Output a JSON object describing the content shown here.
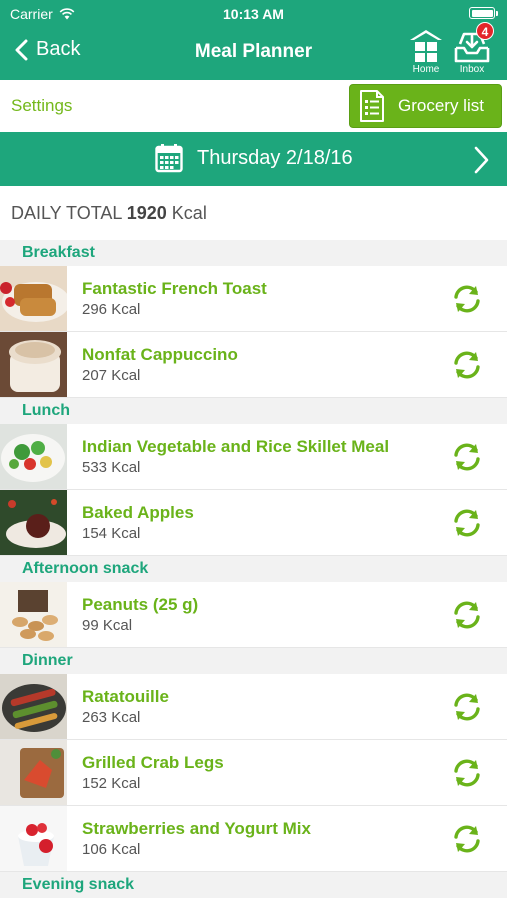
{
  "status_bar": {
    "carrier": "Carrier",
    "time": "10:13 AM"
  },
  "nav": {
    "back_label": "Back",
    "title": "Meal Planner",
    "home_label": "Home",
    "inbox_label": "Inbox",
    "inbox_badge": "4"
  },
  "toolbar": {
    "settings_label": "Settings",
    "grocery_label": "Grocery list"
  },
  "date": {
    "label": "Thursday 2/18/16"
  },
  "daily_total": {
    "prefix": "DAILY TOTAL",
    "value": "1920",
    "unit": "Kcal"
  },
  "sections": [
    {
      "title": "Breakfast",
      "items": [
        {
          "name": "Fantastic French Toast",
          "kcal": "296 Kcal"
        },
        {
          "name": "Nonfat Cappuccino",
          "kcal": "207 Kcal"
        }
      ]
    },
    {
      "title": "Lunch",
      "items": [
        {
          "name": "Indian Vegetable and Rice Skillet Meal",
          "kcal": "533 Kcal"
        },
        {
          "name": "Baked Apples",
          "kcal": "154 Kcal"
        }
      ]
    },
    {
      "title": "Afternoon snack",
      "items": [
        {
          "name": "Peanuts (25 g)",
          "kcal": "99 Kcal"
        }
      ]
    },
    {
      "title": "Dinner",
      "items": [
        {
          "name": "Ratatouille",
          "kcal": "263 Kcal"
        },
        {
          "name": "Grilled Crab Legs",
          "kcal": "152 Kcal"
        },
        {
          "name": "Strawberries and Yogurt Mix",
          "kcal": "106 Kcal"
        }
      ]
    },
    {
      "title": "Evening snack",
      "items": []
    }
  ],
  "colors": {
    "header": "#1ea67c",
    "accent_green": "#6ab31a",
    "badge": "#e3252a"
  },
  "icons": [
    "wifi-icon",
    "battery-icon",
    "back-chevron-icon",
    "home-icon",
    "inbox-download-icon",
    "grocery-list-icon",
    "calendar-icon",
    "chevron-right-icon",
    "refresh-icon"
  ]
}
